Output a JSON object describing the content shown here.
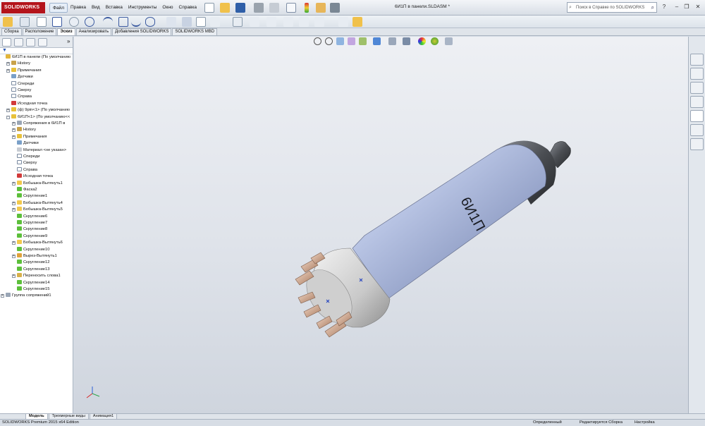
{
  "app": {
    "logo_text": "SOLIDWORKS",
    "window_title": "6И1П в панели.SLDASM *",
    "search_placeholder": "Поиск в Справке по SOLIDWORKS"
  },
  "menu": [
    {
      "label": "Файл",
      "name": "menu-file"
    },
    {
      "label": "Правка",
      "name": "menu-edit"
    },
    {
      "label": "Вид",
      "name": "menu-view"
    },
    {
      "label": "Вставка",
      "name": "menu-insert"
    },
    {
      "label": "Инструменты",
      "name": "menu-tools"
    },
    {
      "label": "Окно",
      "name": "menu-window"
    },
    {
      "label": "Справка",
      "name": "menu-help"
    }
  ],
  "command_tabs": [
    {
      "label": "Сборка"
    },
    {
      "label": "Расположение"
    },
    {
      "label": "Эскиз"
    },
    {
      "label": "Анализировать"
    },
    {
      "label": "Добавления SOLIDWORKS"
    },
    {
      "label": "SOLIDWORKS MBD"
    }
  ],
  "tree": [
    {
      "label": "6И1П в панели  (По умолчанию",
      "indent": 0,
      "icon": "assembly-icon",
      "exp": ""
    },
    {
      "label": "History",
      "indent": 1,
      "icon": "history-icon",
      "exp": "+"
    },
    {
      "label": "Примечания",
      "indent": 1,
      "icon": "annotations-icon",
      "exp": "+"
    },
    {
      "label": "Датчики",
      "indent": 1,
      "icon": "sensors-icon",
      "exp": ""
    },
    {
      "label": "Спереди",
      "indent": 1,
      "icon": "plane-icon",
      "exp": ""
    },
    {
      "label": "Сверху",
      "indent": 1,
      "icon": "plane-icon",
      "exp": ""
    },
    {
      "label": "Справа",
      "indent": 1,
      "icon": "plane-icon",
      "exp": ""
    },
    {
      "label": "Исходная точка",
      "indent": 1,
      "icon": "origin-icon",
      "exp": ""
    },
    {
      "label": "(ф) 9pin<1> (По умолчанию",
      "indent": 1,
      "icon": "part-icon",
      "exp": "+"
    },
    {
      "label": "6И1П<1> (По умолчанию<<",
      "indent": 1,
      "icon": "part-icon",
      "exp": "-"
    },
    {
      "label": "Сопряжения в 6И1П в",
      "indent": 2,
      "icon": "mates-icon",
      "exp": "+"
    },
    {
      "label": "History",
      "indent": 2,
      "icon": "history-icon",
      "exp": "+"
    },
    {
      "label": "Примечания",
      "indent": 2,
      "icon": "annotations-icon",
      "exp": "+"
    },
    {
      "label": "Датчики",
      "indent": 2,
      "icon": "sensors-icon",
      "exp": ""
    },
    {
      "label": "Материал <не указан>",
      "indent": 2,
      "icon": "material-icon",
      "exp": ""
    },
    {
      "label": "Спереди",
      "indent": 2,
      "icon": "plane-icon",
      "exp": ""
    },
    {
      "label": "Сверху",
      "indent": 2,
      "icon": "plane-icon",
      "exp": ""
    },
    {
      "label": "Справа",
      "indent": 2,
      "icon": "plane-icon",
      "exp": ""
    },
    {
      "label": "Исходная точка",
      "indent": 2,
      "icon": "origin-icon",
      "exp": ""
    },
    {
      "label": "Бобышка-Вытянуть1",
      "indent": 2,
      "icon": "feature-icon",
      "exp": "+"
    },
    {
      "label": "Фаска2",
      "indent": 2,
      "icon": "fillet-icon",
      "exp": ""
    },
    {
      "label": "Скругление1",
      "indent": 2,
      "icon": "fillet-icon",
      "exp": ""
    },
    {
      "label": "Бобышка-Вытянуть4",
      "indent": 2,
      "icon": "feature-icon",
      "exp": "+"
    },
    {
      "label": "Бобышка-Вытянуть5",
      "indent": 2,
      "icon": "feature-icon",
      "exp": "+"
    },
    {
      "label": "Скругление6",
      "indent": 2,
      "icon": "fillet-icon",
      "exp": ""
    },
    {
      "label": "Скругление7",
      "indent": 2,
      "icon": "fillet-icon",
      "exp": ""
    },
    {
      "label": "Скругление8",
      "indent": 2,
      "icon": "fillet-icon",
      "exp": ""
    },
    {
      "label": "Скругление9",
      "indent": 2,
      "icon": "fillet-icon",
      "exp": ""
    },
    {
      "label": "Бобышка-Вытянуть6",
      "indent": 2,
      "icon": "feature-icon",
      "exp": "+"
    },
    {
      "label": "Скругление10",
      "indent": 2,
      "icon": "fillet-icon",
      "exp": ""
    },
    {
      "label": "Вырез-Вытянуть1",
      "indent": 2,
      "icon": "cut-icon",
      "exp": "+"
    },
    {
      "label": "Скругление12",
      "indent": 2,
      "icon": "fillet-icon",
      "exp": ""
    },
    {
      "label": "Скругление13",
      "indent": 2,
      "icon": "fillet-icon",
      "exp": ""
    },
    {
      "label": "Переносить слова1",
      "indent": 2,
      "icon": "wrap-icon",
      "exp": "+"
    },
    {
      "label": "Скругление14",
      "indent": 2,
      "icon": "fillet-icon",
      "exp": ""
    },
    {
      "label": "Скругление15",
      "indent": 2,
      "icon": "fillet-icon",
      "exp": ""
    },
    {
      "label": "Группа сопряжений1",
      "indent": 0,
      "icon": "mates-icon",
      "exp": "+"
    }
  ],
  "model_label": "6И1П",
  "bottom_tabs": [
    {
      "label": "Модель"
    },
    {
      "label": "Трехмерные виды"
    },
    {
      "label": "Анимация1"
    }
  ],
  "status": {
    "left": "SOLIDWORKS Premium 2015 x64 Edition",
    "state": "Определенный",
    "mode": "Редактируется Сборка",
    "settings": "Настройка"
  },
  "colors": {
    "accent": "#b4141b",
    "tube_body": "#a9b8dc",
    "tube_cap": "#4a4d52",
    "pins": "#c9a48a"
  }
}
